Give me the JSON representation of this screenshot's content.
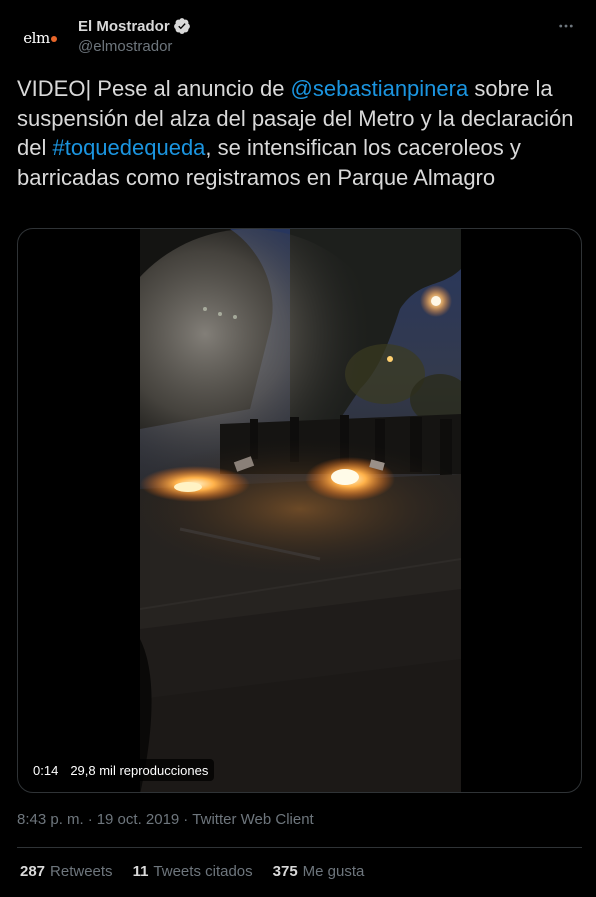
{
  "author": {
    "avatar_text": "elm",
    "display_name": "El Mostrador",
    "handle": "@elmostrador",
    "verified_icon": "verified-badge-icon"
  },
  "more_icon": "more-options-icon",
  "tweet": {
    "text_parts": {
      "p1": "VIDEO| Pese al anuncio de ",
      "mention": "@sebastianpinera",
      "p2": " sobre la suspensión del alza del pasaje del Metro y la declaración del ",
      "hashtag": "#toquedequeda",
      "p3": ", se intensifican los caceroleos y barricadas como registramos en Parque Almagro"
    },
    "link_color": "#1b95e0"
  },
  "media": {
    "duration": "0:14",
    "views": "29,8 mil reproducciones"
  },
  "meta": {
    "time": "8:43 p. m.",
    "separator": "·",
    "date": "19 oct. 2019",
    "client": "Twitter Web Client"
  },
  "stats": {
    "retweets_count": "287",
    "retweets_label": "Retweets",
    "quotes_count": "11",
    "quotes_label": "Tweets citados",
    "likes_count": "375",
    "likes_label": "Me gusta"
  },
  "colors": {
    "background": "#000000",
    "text": "#d9d9d9",
    "secondary": "#6e767d",
    "border": "#2f3336",
    "brand_dot": "#e8662a"
  }
}
